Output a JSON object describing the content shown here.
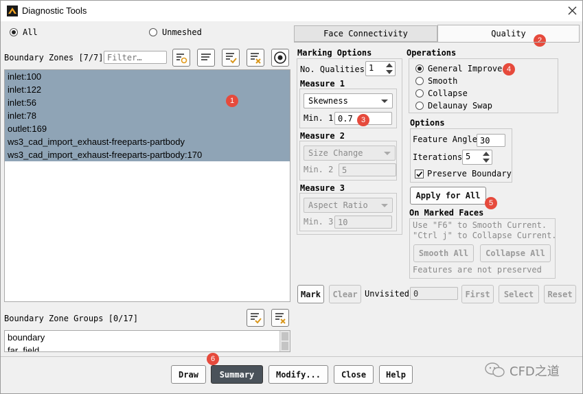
{
  "window": {
    "title": "Diagnostic Tools"
  },
  "filter": {
    "all_label": "All",
    "unmeshed_label": "Unmeshed"
  },
  "boundary_zones": {
    "label": "Boundary Zones [7/7]",
    "filter_placeholder": "Filter…",
    "items": [
      "inlet:100",
      "inlet:122",
      "inlet:56",
      "inlet:78",
      "outlet:169",
      "ws3_cad_import_exhaust-freeparts-partbody",
      "ws3_cad_import_exhaust-freeparts-partbody:170"
    ]
  },
  "zone_groups": {
    "label": "Boundary Zone Groups [0/17]",
    "items": [
      "boundary",
      "far_field"
    ]
  },
  "tabs": {
    "face_connectivity": "Face Connectivity",
    "quality": "Quality"
  },
  "marking": {
    "title": "Marking Options",
    "no_qualities_label": "No. Qualities",
    "no_qualities_value": "1",
    "measure1": {
      "title": "Measure 1",
      "select": "Skewness",
      "min_label": "Min. 1",
      "min_value": "0.7"
    },
    "measure2": {
      "title": "Measure 2",
      "select": "Size Change",
      "min_label": "Min. 2",
      "min_value": "5"
    },
    "measure3": {
      "title": "Measure 3",
      "select": "Aspect Ratio",
      "min_label": "Min. 3",
      "min_value": "10"
    }
  },
  "operations": {
    "title": "Operations",
    "items": [
      "General Improve",
      "Smooth",
      "Collapse",
      "Delaunay Swap"
    ],
    "selected_index": 0
  },
  "options": {
    "title": "Options",
    "feature_angle_label": "Feature Angle",
    "feature_angle_value": "30",
    "iterations_label": "Iterations",
    "iterations_value": "5",
    "preserve_label": "Preserve Boundary",
    "preserve_checked": true
  },
  "apply_all_label": "Apply for All",
  "marked_faces": {
    "title": "On Marked Faces",
    "hint1": "Use \"F6\" to Smooth Current.",
    "hint2": "\"Ctrl j\" to Collapse Current.",
    "smooth_all": "Smooth All",
    "collapse_all": "Collapse All",
    "note": "Features are not preserved"
  },
  "mark_row": {
    "mark": "Mark",
    "clear": "Clear",
    "unvisited_label": "Unvisited",
    "unvisited_value": "0",
    "first": "First",
    "select": "Select",
    "reset": "Reset"
  },
  "footer": {
    "draw": "Draw",
    "summary": "Summary",
    "modify": "Modify...",
    "close": "Close",
    "help": "Help"
  },
  "badges": [
    "1",
    "2",
    "3",
    "4",
    "5",
    "6"
  ],
  "watermark": {
    "text": "CFD之道"
  },
  "colors": {
    "selection": "#8fa4b6",
    "badge": "#e64a3c",
    "summary_button": "#4a525a"
  }
}
